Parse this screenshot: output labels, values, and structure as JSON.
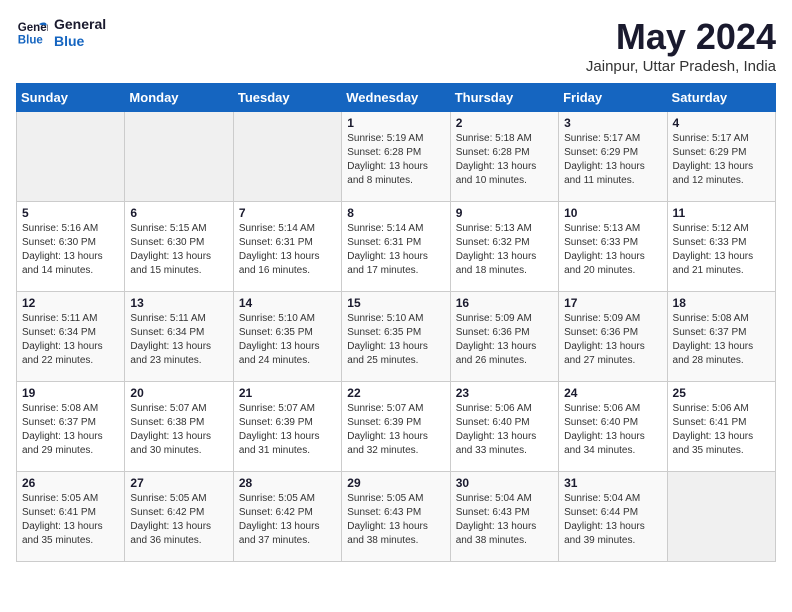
{
  "logo": {
    "line1": "General",
    "line2": "Blue"
  },
  "header": {
    "month": "May 2024",
    "location": "Jainpur, Uttar Pradesh, India"
  },
  "weekdays": [
    "Sunday",
    "Monday",
    "Tuesday",
    "Wednesday",
    "Thursday",
    "Friday",
    "Saturday"
  ],
  "weeks": [
    [
      {
        "day": "",
        "empty": true
      },
      {
        "day": "",
        "empty": true
      },
      {
        "day": "",
        "empty": true
      },
      {
        "day": "1",
        "sunrise": "5:19 AM",
        "sunset": "6:28 PM",
        "daylight": "13 hours and 8 minutes."
      },
      {
        "day": "2",
        "sunrise": "5:18 AM",
        "sunset": "6:28 PM",
        "daylight": "13 hours and 10 minutes."
      },
      {
        "day": "3",
        "sunrise": "5:17 AM",
        "sunset": "6:29 PM",
        "daylight": "13 hours and 11 minutes."
      },
      {
        "day": "4",
        "sunrise": "5:17 AM",
        "sunset": "6:29 PM",
        "daylight": "13 hours and 12 minutes."
      }
    ],
    [
      {
        "day": "5",
        "sunrise": "5:16 AM",
        "sunset": "6:30 PM",
        "daylight": "13 hours and 14 minutes."
      },
      {
        "day": "6",
        "sunrise": "5:15 AM",
        "sunset": "6:30 PM",
        "daylight": "13 hours and 15 minutes."
      },
      {
        "day": "7",
        "sunrise": "5:14 AM",
        "sunset": "6:31 PM",
        "daylight": "13 hours and 16 minutes."
      },
      {
        "day": "8",
        "sunrise": "5:14 AM",
        "sunset": "6:31 PM",
        "daylight": "13 hours and 17 minutes."
      },
      {
        "day": "9",
        "sunrise": "5:13 AM",
        "sunset": "6:32 PM",
        "daylight": "13 hours and 18 minutes."
      },
      {
        "day": "10",
        "sunrise": "5:13 AM",
        "sunset": "6:33 PM",
        "daylight": "13 hours and 20 minutes."
      },
      {
        "day": "11",
        "sunrise": "5:12 AM",
        "sunset": "6:33 PM",
        "daylight": "13 hours and 21 minutes."
      }
    ],
    [
      {
        "day": "12",
        "sunrise": "5:11 AM",
        "sunset": "6:34 PM",
        "daylight": "13 hours and 22 minutes."
      },
      {
        "day": "13",
        "sunrise": "5:11 AM",
        "sunset": "6:34 PM",
        "daylight": "13 hours and 23 minutes."
      },
      {
        "day": "14",
        "sunrise": "5:10 AM",
        "sunset": "6:35 PM",
        "daylight": "13 hours and 24 minutes."
      },
      {
        "day": "15",
        "sunrise": "5:10 AM",
        "sunset": "6:35 PM",
        "daylight": "13 hours and 25 minutes."
      },
      {
        "day": "16",
        "sunrise": "5:09 AM",
        "sunset": "6:36 PM",
        "daylight": "13 hours and 26 minutes."
      },
      {
        "day": "17",
        "sunrise": "5:09 AM",
        "sunset": "6:36 PM",
        "daylight": "13 hours and 27 minutes."
      },
      {
        "day": "18",
        "sunrise": "5:08 AM",
        "sunset": "6:37 PM",
        "daylight": "13 hours and 28 minutes."
      }
    ],
    [
      {
        "day": "19",
        "sunrise": "5:08 AM",
        "sunset": "6:37 PM",
        "daylight": "13 hours and 29 minutes."
      },
      {
        "day": "20",
        "sunrise": "5:07 AM",
        "sunset": "6:38 PM",
        "daylight": "13 hours and 30 minutes."
      },
      {
        "day": "21",
        "sunrise": "5:07 AM",
        "sunset": "6:39 PM",
        "daylight": "13 hours and 31 minutes."
      },
      {
        "day": "22",
        "sunrise": "5:07 AM",
        "sunset": "6:39 PM",
        "daylight": "13 hours and 32 minutes."
      },
      {
        "day": "23",
        "sunrise": "5:06 AM",
        "sunset": "6:40 PM",
        "daylight": "13 hours and 33 minutes."
      },
      {
        "day": "24",
        "sunrise": "5:06 AM",
        "sunset": "6:40 PM",
        "daylight": "13 hours and 34 minutes."
      },
      {
        "day": "25",
        "sunrise": "5:06 AM",
        "sunset": "6:41 PM",
        "daylight": "13 hours and 35 minutes."
      }
    ],
    [
      {
        "day": "26",
        "sunrise": "5:05 AM",
        "sunset": "6:41 PM",
        "daylight": "13 hours and 35 minutes."
      },
      {
        "day": "27",
        "sunrise": "5:05 AM",
        "sunset": "6:42 PM",
        "daylight": "13 hours and 36 minutes."
      },
      {
        "day": "28",
        "sunrise": "5:05 AM",
        "sunset": "6:42 PM",
        "daylight": "13 hours and 37 minutes."
      },
      {
        "day": "29",
        "sunrise": "5:05 AM",
        "sunset": "6:43 PM",
        "daylight": "13 hours and 38 minutes."
      },
      {
        "day": "30",
        "sunrise": "5:04 AM",
        "sunset": "6:43 PM",
        "daylight": "13 hours and 38 minutes."
      },
      {
        "day": "31",
        "sunrise": "5:04 AM",
        "sunset": "6:44 PM",
        "daylight": "13 hours and 39 minutes."
      },
      {
        "day": "",
        "empty": true
      }
    ]
  ]
}
